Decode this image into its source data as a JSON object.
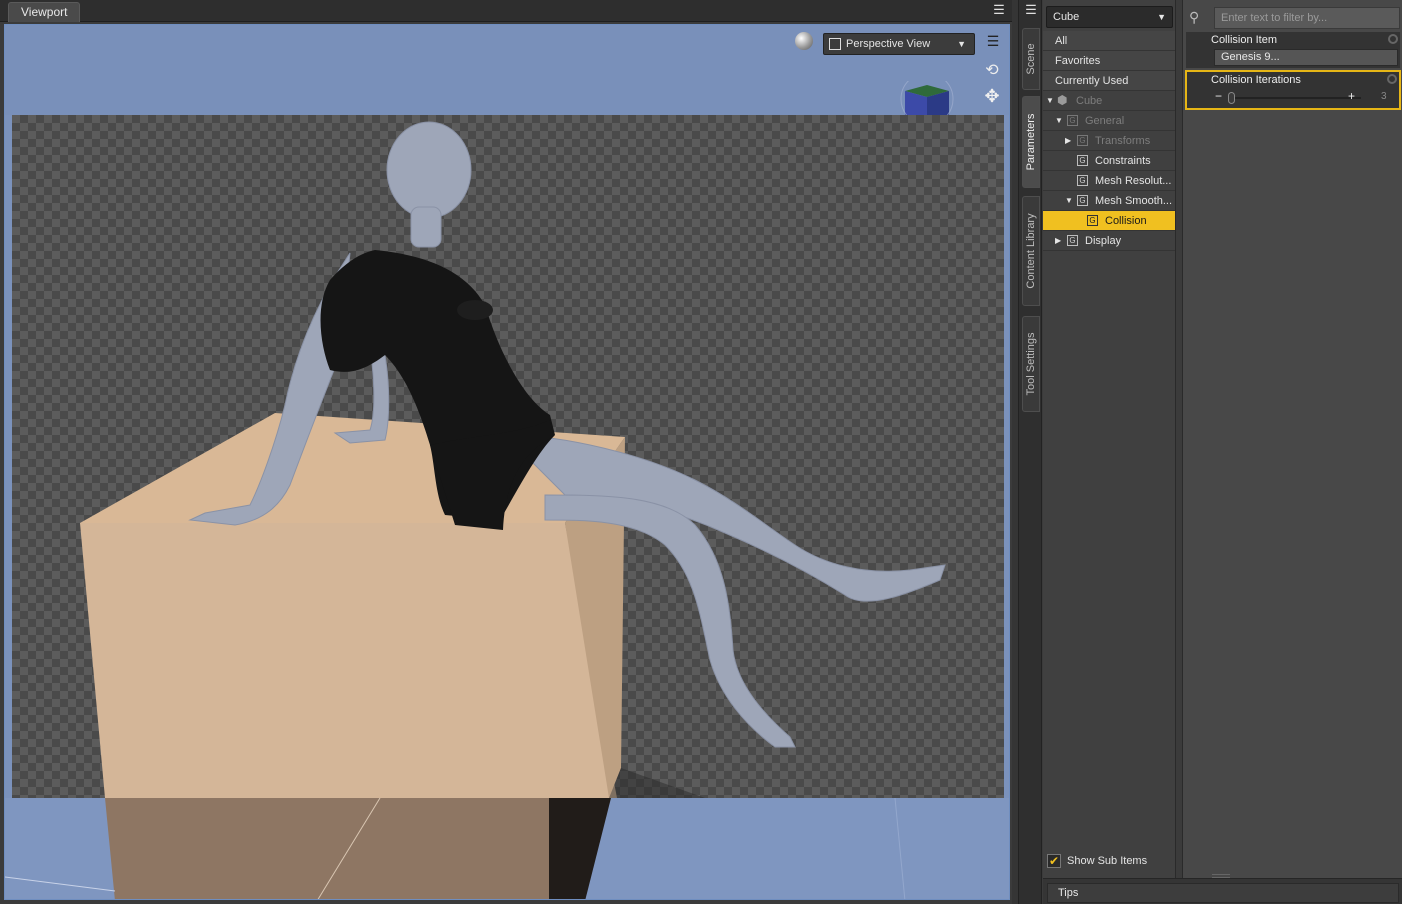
{
  "viewport": {
    "tab_label": "Viewport",
    "view_label": "Perspective View"
  },
  "side_tabs": [
    "Scene",
    "Parameters",
    "Content Library",
    "Tool Settings"
  ],
  "params": {
    "node_name": "Cube",
    "quick": [
      "All",
      "Favorites",
      "Currently Used"
    ],
    "tree": [
      {
        "label": "Cube"
      },
      {
        "label": "General"
      },
      {
        "label": "Transforms"
      },
      {
        "label": "Constraints"
      },
      {
        "label": "Mesh Resolut..."
      },
      {
        "label": "Mesh Smooth..."
      },
      {
        "label": "Collision"
      },
      {
        "label": "Display"
      }
    ],
    "show_sub_items": "Show Sub Items",
    "show_sub_checked": true
  },
  "properties": {
    "filter_placeholder": "Enter text to filter by...",
    "collision_item_label": "Collision Item",
    "collision_item_value": "Genesis 9...",
    "collision_iterations_label": "Collision Iterations",
    "collision_iterations_value": "3",
    "collision_iterations_fraction": 0.0
  },
  "bottom": {
    "tips_label": "Tips"
  },
  "colors": {
    "accent": "#f0c020",
    "viewport_bg": "#7b92bc"
  }
}
